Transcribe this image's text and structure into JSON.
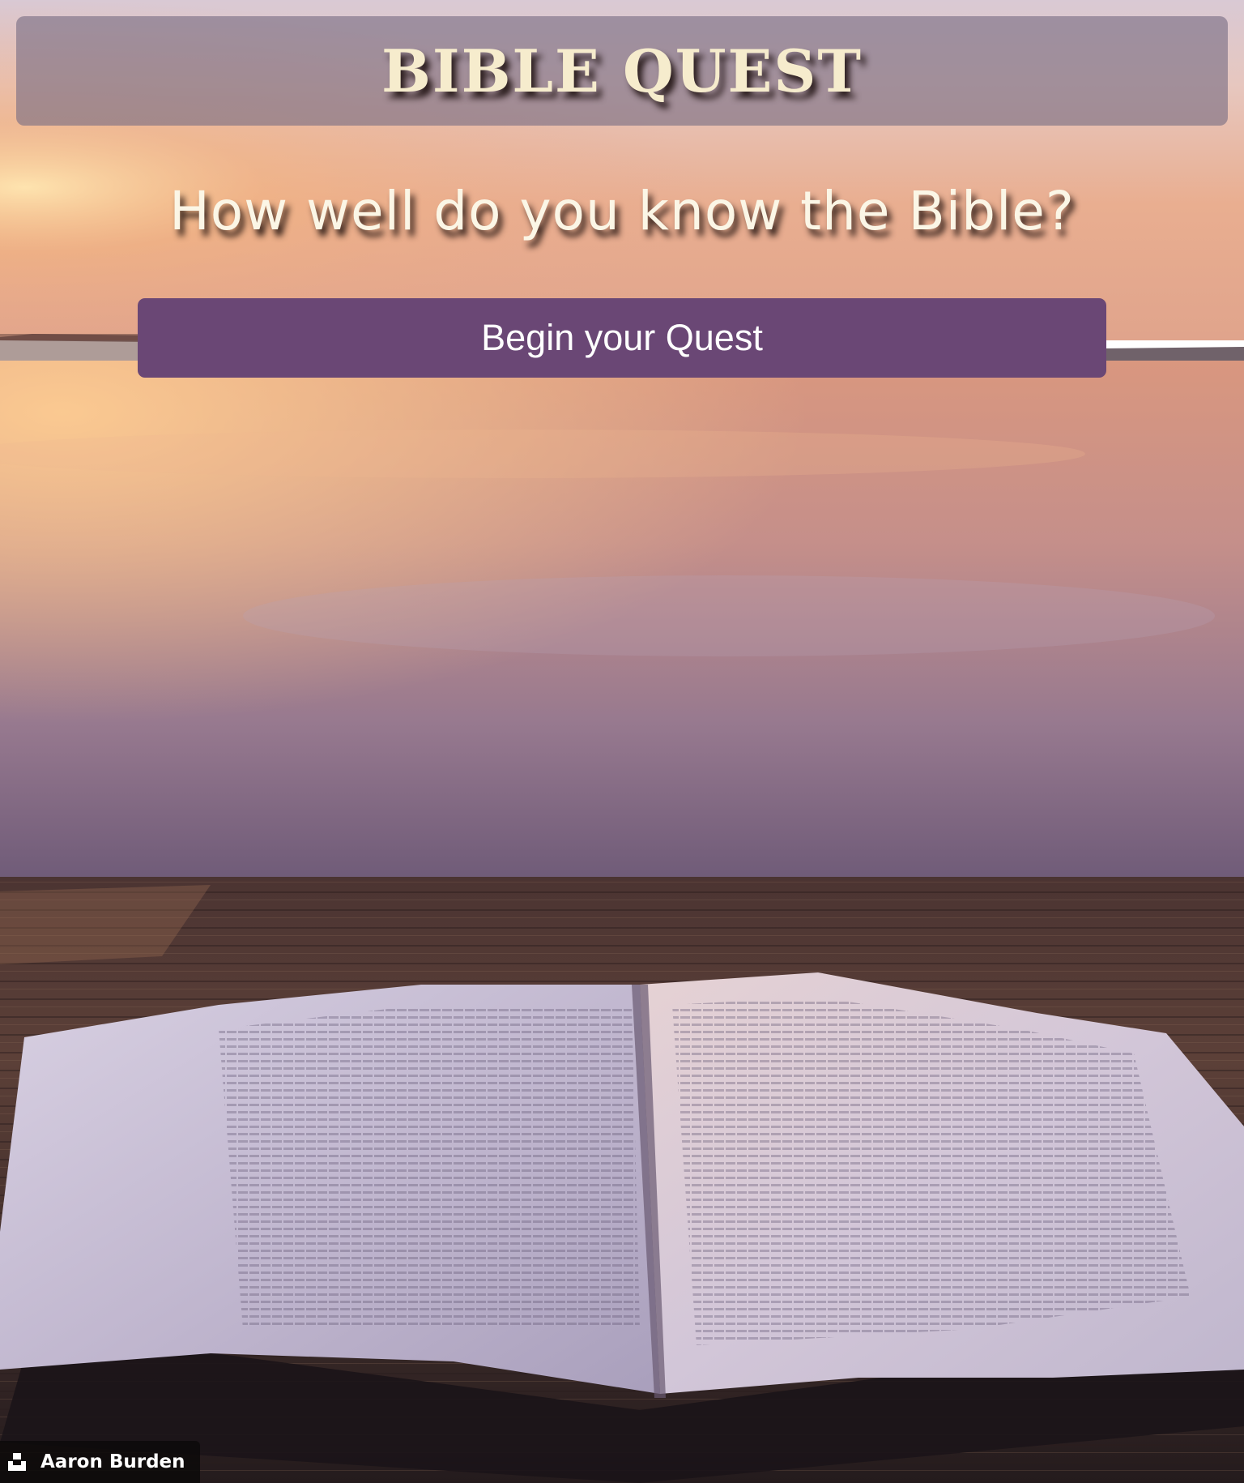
{
  "header": {
    "title": "BIBLE QUEST"
  },
  "hero": {
    "tagline": "How well do you know the Bible?",
    "begin_button_label": "Begin your Quest"
  },
  "background": {
    "description_icon": "open-bible-lake-sunset-image"
  },
  "credit": {
    "icon": "unsplash-icon",
    "name": "Aaron Burden"
  },
  "colors": {
    "button": "#6a4775",
    "title_text": "#f6eccd",
    "header_bar": "#786c82"
  }
}
